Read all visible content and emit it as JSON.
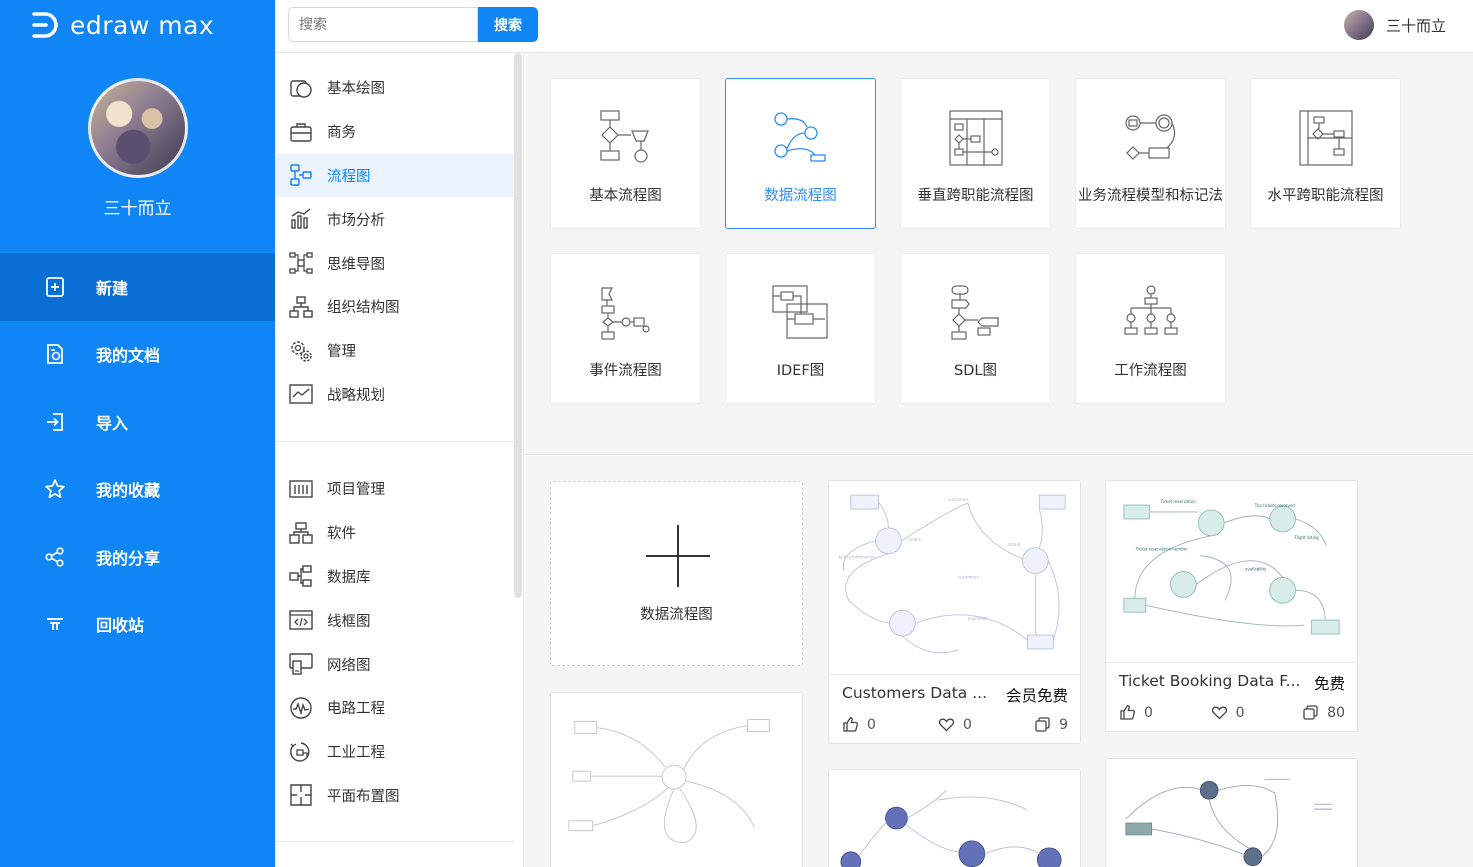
{
  "app": {
    "logo_text": "edraw max",
    "brand_color": "#0f85f6"
  },
  "user": {
    "name": "三十而立"
  },
  "nav": [
    {
      "label": "新建",
      "icon": "new-file-icon",
      "active": true
    },
    {
      "label": "我的文档",
      "icon": "documents-icon"
    },
    {
      "label": "导入",
      "icon": "import-icon"
    },
    {
      "label": "我的收藏",
      "icon": "star-icon"
    },
    {
      "label": "我的分享",
      "icon": "share-icon"
    },
    {
      "label": "回收站",
      "icon": "recycle-bin-icon"
    }
  ],
  "search": {
    "placeholder": "搜索",
    "button": "搜索"
  },
  "categories_primary": [
    {
      "label": "基本绘图",
      "icon": "basic-drawing-icon"
    },
    {
      "label": "商务",
      "icon": "briefcase-icon"
    },
    {
      "label": "流程图",
      "icon": "flowchart-icon",
      "active": true
    },
    {
      "label": "市场分析",
      "icon": "bar-chart-icon"
    },
    {
      "label": "思维导图",
      "icon": "mindmap-icon"
    },
    {
      "label": "组织结构图",
      "icon": "org-chart-icon"
    },
    {
      "label": "管理",
      "icon": "management-icon"
    },
    {
      "label": "战略规划",
      "icon": "strategy-icon"
    }
  ],
  "categories_secondary": [
    {
      "label": "项目管理",
      "icon": "project-icon"
    },
    {
      "label": "软件",
      "icon": "software-icon"
    },
    {
      "label": "数据库",
      "icon": "database-icon"
    },
    {
      "label": "线框图",
      "icon": "wireframe-icon"
    },
    {
      "label": "网络图",
      "icon": "network-icon"
    },
    {
      "label": "电路工程",
      "icon": "circuit-icon"
    },
    {
      "label": "工业工程",
      "icon": "industrial-icon"
    },
    {
      "label": "平面布置图",
      "icon": "floorplan-icon"
    }
  ],
  "template_types": [
    {
      "label": "基本流程图"
    },
    {
      "label": "数据流程图",
      "active": true
    },
    {
      "label": "垂直跨职能流程图"
    },
    {
      "label": "业务流程模型和标记法"
    },
    {
      "label": "水平跨职能流程图"
    },
    {
      "label": "事件流程图"
    },
    {
      "label": "IDEF图"
    },
    {
      "label": "SDL图"
    },
    {
      "label": "工作流程图"
    }
  ],
  "new_card": {
    "label": "数据流程图"
  },
  "templates": [
    {
      "title": "Customers Data ...",
      "badge": "会员免费",
      "likes": "0",
      "favorites": "0",
      "copies": "9"
    },
    {
      "title": "Ticket Booking Data F...",
      "badge": "免费",
      "likes": "0",
      "favorites": "0",
      "copies": "80"
    }
  ]
}
